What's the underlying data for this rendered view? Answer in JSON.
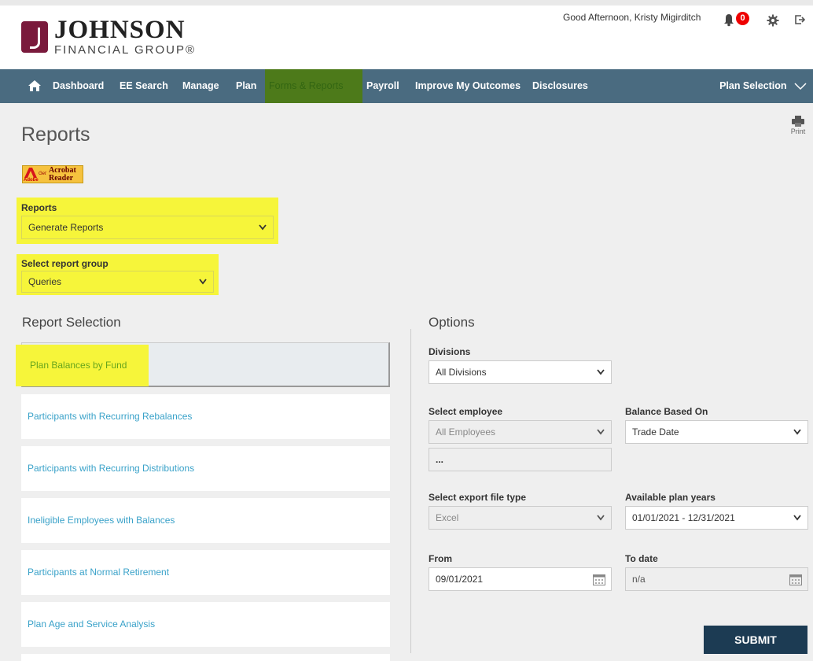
{
  "brand": {
    "name": "JOHNSON",
    "sub": "FINANCIAL GROUP®"
  },
  "header": {
    "greeting": "Good Afternoon,  Kristy Migirditch",
    "notifications_count": "0"
  },
  "nav": {
    "items": [
      {
        "label": "Dashboard"
      },
      {
        "label": "EE Search"
      },
      {
        "label": "Manage"
      },
      {
        "label": "Plan"
      },
      {
        "label": "Forms & Reports"
      },
      {
        "label": "Payroll"
      },
      {
        "label": "Improve My Outcomes"
      },
      {
        "label": "Disclosures"
      }
    ],
    "plan_selection": "Plan Selection"
  },
  "page": {
    "title": "Reports",
    "print_label": "Print"
  },
  "acrobat": {
    "adobe": "Adobe",
    "get": "Get",
    "line1": "Acrobat",
    "line2": "Reader"
  },
  "reports_field": {
    "label": "Reports",
    "value": "Generate Reports"
  },
  "report_group": {
    "label": "Select report group",
    "value": "Queries"
  },
  "report_selection": {
    "title": "Report Selection",
    "items": [
      {
        "label": "Plan Balances by Fund"
      },
      {
        "label": "Participants with Recurring Rebalances"
      },
      {
        "label": "Participants with Recurring Distributions"
      },
      {
        "label": "Ineligible Employees with Balances"
      },
      {
        "label": "Participants at Normal Retirement"
      },
      {
        "label": "Plan Age and Service Analysis"
      }
    ]
  },
  "options": {
    "title": "Options",
    "divisions": {
      "label": "Divisions",
      "value": "All Divisions"
    },
    "employee": {
      "label": "Select employee",
      "value": "All Employees",
      "extra": "..."
    },
    "balance": {
      "label": "Balance Based On",
      "value": "Trade Date"
    },
    "export": {
      "label": "Select export file type",
      "value": "Excel"
    },
    "plan_years": {
      "label": "Available plan years",
      "value": "01/01/2021 - 12/31/2021"
    },
    "from": {
      "label": "From",
      "value": "09/01/2021"
    },
    "to": {
      "label": "To date",
      "value": "n/a"
    },
    "submit": "SUBMIT"
  },
  "colors": {
    "nav": "#4a6b80",
    "highlight": "#f6f53a",
    "link": "#3aa2c9",
    "submit": "#1c3b53",
    "badge": "#e00000",
    "brand": "#7a1a3c"
  }
}
